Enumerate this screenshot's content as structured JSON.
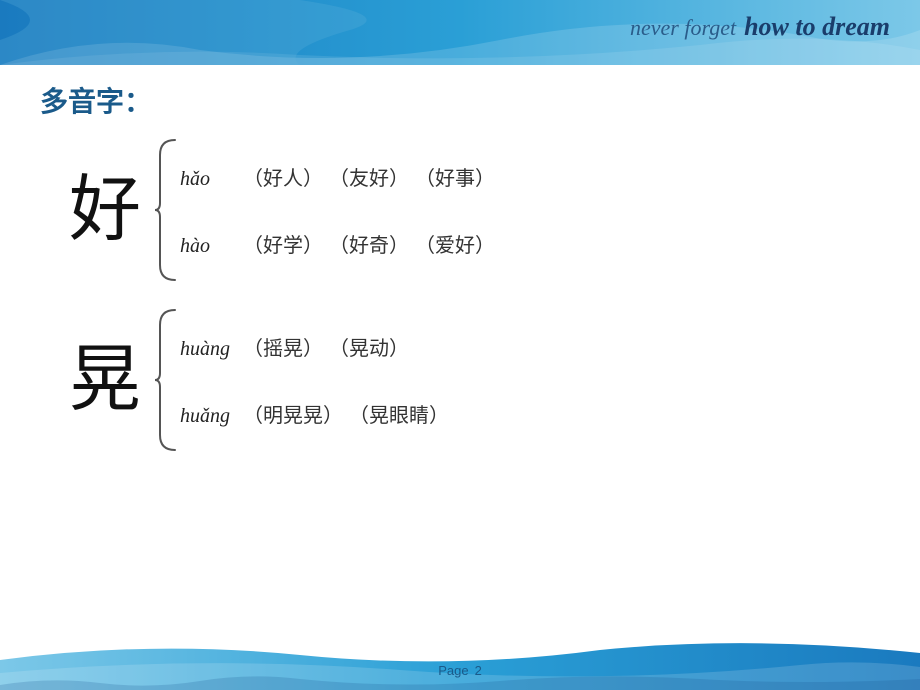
{
  "header": {
    "tagline_never": "never forget",
    "tagline_dream": "how to dream"
  },
  "page": {
    "number_label": "Page",
    "number": "2"
  },
  "title": "多音字：",
  "characters": [
    {
      "char": "好",
      "entries": [
        {
          "pinyin": "hǎo",
          "examples": [
            "（好人）",
            "（友好）",
            "（好事）"
          ]
        },
        {
          "pinyin": "hào",
          "examples": [
            "（好学）",
            "（好奇）",
            "（爱好）"
          ]
        }
      ]
    },
    {
      "char": "晃",
      "entries": [
        {
          "pinyin": "huàng",
          "examples": [
            "（摇晃）",
            "（晃动）"
          ]
        },
        {
          "pinyin": "huǎng",
          "examples": [
            "（明晃晃）",
            "（晃眼睛）"
          ]
        }
      ]
    }
  ]
}
